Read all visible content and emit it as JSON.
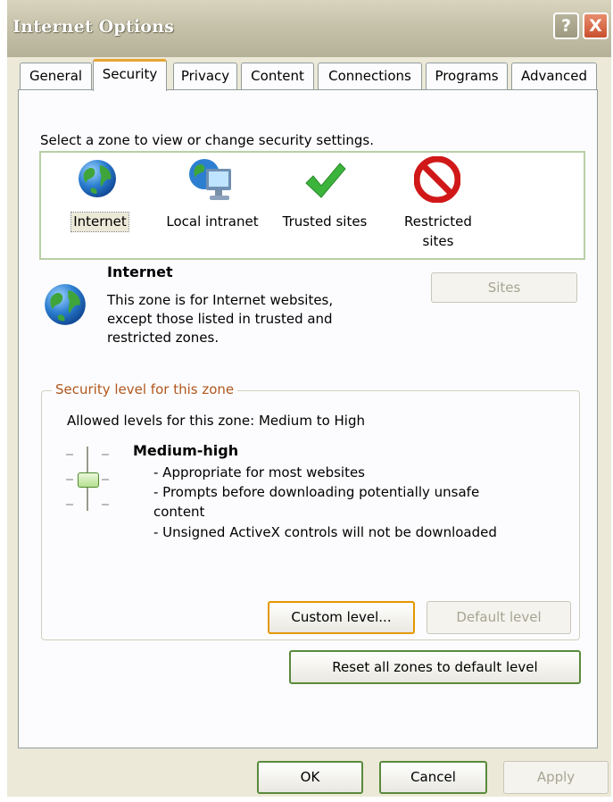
{
  "window": {
    "title": "Internet Options",
    "help_label": "?",
    "close_label": "X"
  },
  "tabs": [
    {
      "label": "General"
    },
    {
      "label": "Security",
      "active": true
    },
    {
      "label": "Privacy"
    },
    {
      "label": "Content"
    },
    {
      "label": "Connections"
    },
    {
      "label": "Programs"
    },
    {
      "label": "Advanced"
    }
  ],
  "zones": {
    "prompt": "Select a zone to view or change security settings.",
    "items": [
      {
        "label": "Internet",
        "icon": "globe-icon",
        "selected": true
      },
      {
        "label": "Local intranet",
        "icon": "intranet-computer-icon"
      },
      {
        "label": "Trusted sites",
        "icon": "green-checkmark-icon"
      },
      {
        "label_line1": "Restricted",
        "label_line2": "sites",
        "icon": "no-entry-icon"
      }
    ]
  },
  "zone_info": {
    "title": "Internet",
    "desc_lines": [
      "This zone is for Internet websites,",
      "except those listed in trusted and",
      "restricted zones."
    ],
    "sites_button": "Sites"
  },
  "security_level": {
    "group_title": "Security level for this zone",
    "allowed": "Allowed levels for this zone: Medium to High",
    "level_name": "Medium-high",
    "bullets": [
      "- Appropriate for most websites",
      "- Prompts before downloading potentially unsafe",
      "content",
      "- Unsigned ActiveX controls will not be downloaded"
    ],
    "custom_button": "Custom level...",
    "default_button": "Default level"
  },
  "reset_button": "Reset all zones to default level",
  "footer": {
    "ok": "OK",
    "cancel": "Cancel",
    "apply": "Apply"
  },
  "colors": {
    "title_bar": "#c6c2aa",
    "dialog_bg": "#ece9d8",
    "active_tab_accent": "#e6a534",
    "group_title": "#b0571c",
    "close_button": "#c9502f"
  }
}
